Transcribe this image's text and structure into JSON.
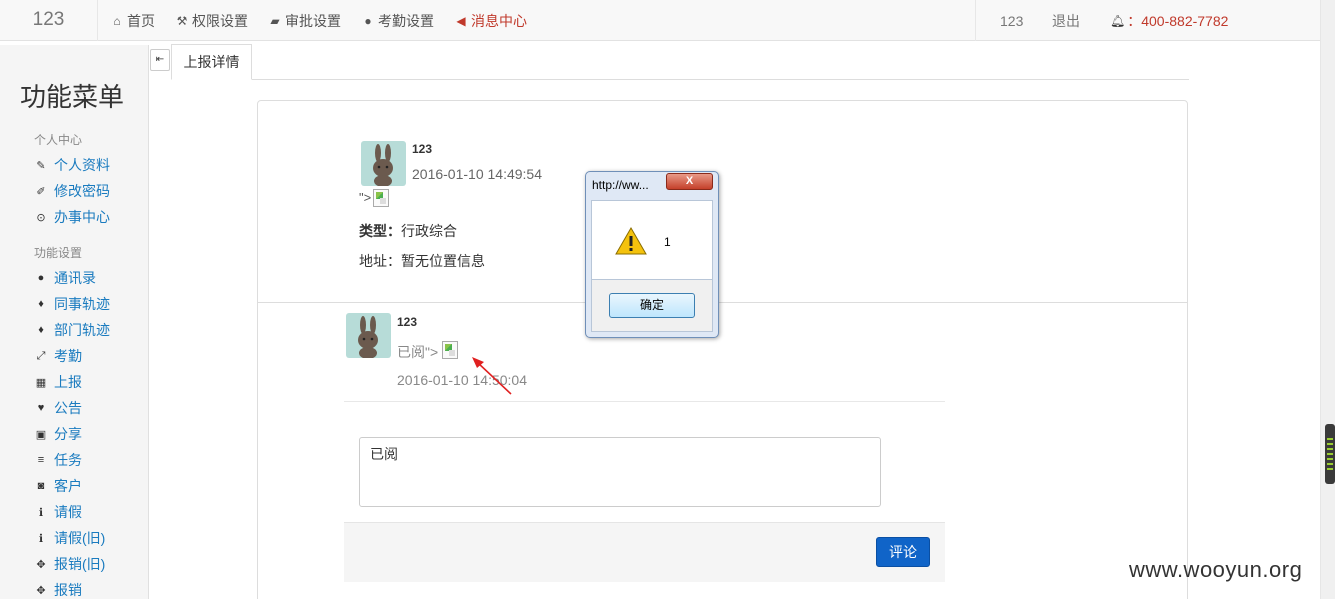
{
  "navbar": {
    "brand": "123",
    "items": [
      {
        "label": "首页",
        "icon": "home-icon",
        "glyph": "⌂"
      },
      {
        "label": "权限设置",
        "icon": "wrench-icon",
        "glyph": "⚒"
      },
      {
        "label": "审批设置",
        "icon": "folder-icon",
        "glyph": "▰"
      },
      {
        "label": "考勤设置",
        "icon": "globe-icon",
        "glyph": "●"
      },
      {
        "label": "消息中心",
        "icon": "bullhorn-icon",
        "glyph": "◀",
        "active": true
      }
    ],
    "user": "123",
    "logout": "退出",
    "phone_icon": "bell-icon",
    "phone": "400-882-7782"
  },
  "sidebar": {
    "title": "功能菜单",
    "groups": [
      {
        "label": "个人中心",
        "items": [
          {
            "label": "个人资料",
            "icon": "edit-icon",
            "glyph": "✎"
          },
          {
            "label": "修改密码",
            "icon": "pencil-icon",
            "glyph": "✐"
          },
          {
            "label": "办事中心",
            "icon": "check-circle-icon",
            "glyph": "⊙"
          }
        ]
      },
      {
        "label": "功能设置",
        "items": [
          {
            "label": "通讯录",
            "icon": "user-icon",
            "glyph": "●"
          },
          {
            "label": "同事轨迹",
            "icon": "map-marker-icon",
            "glyph": "♦"
          },
          {
            "label": "部门轨迹",
            "icon": "map-marker-icon",
            "glyph": "♦"
          },
          {
            "label": "考勤",
            "icon": "resize-icon",
            "glyph": "⤢"
          },
          {
            "label": "上报",
            "icon": "calendar-icon",
            "glyph": "▦"
          },
          {
            "label": "公告",
            "icon": "heart-icon",
            "glyph": "♥"
          },
          {
            "label": "分享",
            "icon": "gift-icon",
            "glyph": "▣"
          },
          {
            "label": "任务",
            "icon": "list-icon",
            "glyph": "≡"
          },
          {
            "label": "客户",
            "icon": "camera-icon",
            "glyph": "◙"
          },
          {
            "label": "请假",
            "icon": "info-icon",
            "glyph": "ℹ"
          },
          {
            "label": "请假(旧)",
            "icon": "info-icon",
            "glyph": "ℹ"
          },
          {
            "label": "报销(旧)",
            "icon": "move-icon",
            "glyph": "✥"
          },
          {
            "label": "报销",
            "icon": "move-icon",
            "glyph": "✥"
          }
        ]
      }
    ]
  },
  "tabs": {
    "toggle_icon": "sidebar-toggle-icon",
    "active": "上报详情"
  },
  "report": {
    "user": "123",
    "time": "2016-01-10 14:49:54",
    "stray_text": "\">",
    "type_label": "类型：",
    "type_value": "行政综合",
    "address_label": "地址：",
    "address_value": "暂无位置信息"
  },
  "comment": {
    "user": "123",
    "text": "已阅\">",
    "time": "2016-01-10 14:50:04"
  },
  "form": {
    "textarea_value": "已阅",
    "submit": "评论"
  },
  "alert": {
    "title": "http://ww...",
    "close": "X",
    "message": "1",
    "ok": "确定"
  },
  "watermark": "www.wooyun.org",
  "colors": {
    "link": "#1a7bbf",
    "active_nav": "#c0392b",
    "primary_button": "#1064c8"
  }
}
